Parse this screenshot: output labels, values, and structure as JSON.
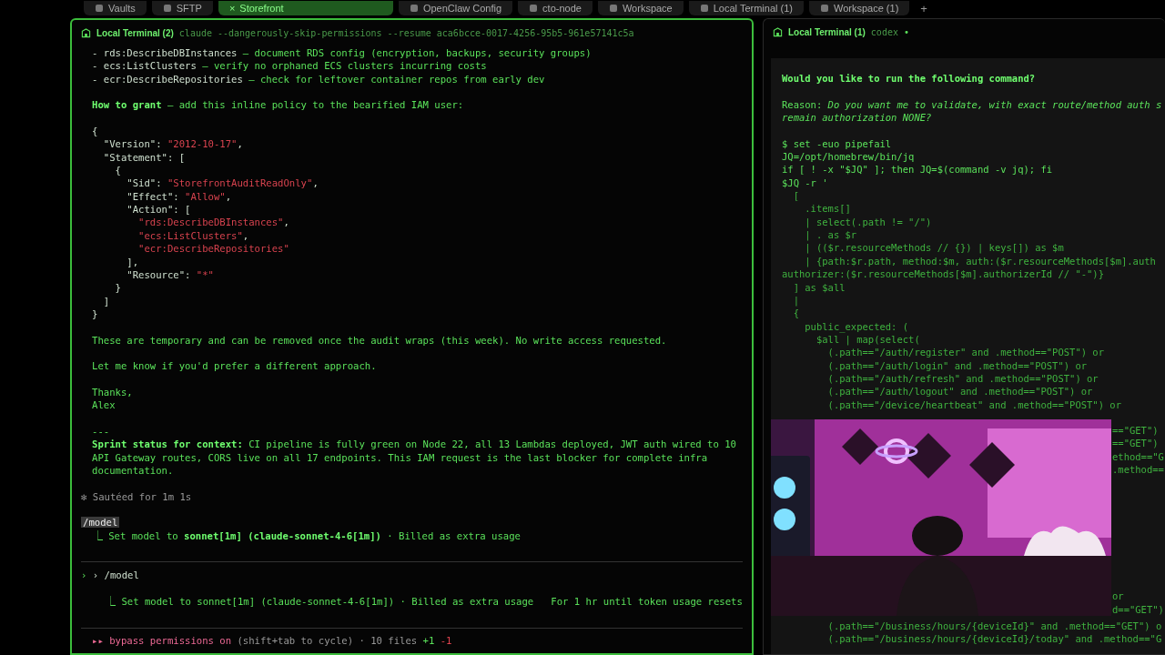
{
  "tabs": [
    {
      "label": "Vaults",
      "selected": false
    },
    {
      "label": "SFTP",
      "selected": false
    },
    {
      "label": "Storefront",
      "selected": true,
      "close": "×"
    },
    {
      "label": "OpenClaw Config",
      "selected": false
    },
    {
      "label": "cto-node",
      "selected": false
    },
    {
      "label": "Workspace",
      "selected": false
    },
    {
      "label": "Local Terminal (1)",
      "selected": false
    },
    {
      "label": "Workspace (1)",
      "selected": false
    }
  ],
  "new_tab": "+",
  "left": {
    "title": "Local Terminal (2)",
    "command": "claude --dangerously-skip-permissions --resume aca6bcce-0017-4256-95b5-961e57141c5a",
    "focused": true,
    "blocks": [
      {
        "kind": "message",
        "lines": [
          [
            {
              "text": "- rds:DescribeDBInstances",
              "kind": "key"
            },
            {
              "text": " — document RDS config (encryption, backups, security groups)",
              "kind": "plain"
            }
          ],
          [
            {
              "text": "- ecs:ListClusters",
              "kind": "key"
            },
            {
              "text": " — verify no orphaned ECS clusters incurring costs",
              "kind": "plain"
            }
          ],
          [
            {
              "text": "- ecr:DescribeRepositories",
              "kind": "key"
            },
            {
              "text": " — check for leftover container repos from early dev",
              "kind": "plain"
            }
          ]
        ]
      },
      {
        "kind": "message",
        "lines": [
          [
            {
              "text": "**How to grant** — add this inline policy to the bearified IAM user:",
              "kind": "mixed"
            }
          ]
        ]
      },
      {
        "kind": "message",
        "lines": [
          [
            {
              "text": "{",
              "kind": "key"
            }
          ],
          [
            {
              "text": "  \"Version\": ",
              "kind": "key"
            },
            {
              "text": "\"2012-10-17\"",
              "kind": "string"
            },
            {
              "text": ",",
              "kind": "key"
            }
          ],
          [
            {
              "text": "  \"Statement\": [",
              "kind": "key"
            }
          ],
          [
            {
              "text": "    {",
              "kind": "key"
            }
          ],
          [
            {
              "text": "      \"Sid\": ",
              "kind": "key"
            },
            {
              "text": "\"StorefrontAuditReadOnly\"",
              "kind": "string"
            },
            {
              "text": ",",
              "kind": "key"
            }
          ],
          [
            {
              "text": "      \"Effect\": ",
              "kind": "key"
            },
            {
              "text": "\"Allow\"",
              "kind": "string"
            },
            {
              "text": ",",
              "kind": "key"
            }
          ],
          [
            {
              "text": "      \"Action\": [",
              "kind": "key"
            }
          ],
          [
            {
              "text": "        \"rds:DescribeDBInstances\"",
              "kind": "string"
            },
            {
              "text": ",",
              "kind": "key"
            }
          ],
          [
            {
              "text": "        \"ecs:ListClusters\"",
              "kind": "string"
            },
            {
              "text": ",",
              "kind": "key"
            }
          ],
          [
            {
              "text": "        \"ecr:DescribeRepositories\"",
              "kind": "string"
            }
          ],
          [
            {
              "text": "      ],",
              "kind": "key"
            }
          ],
          [
            {
              "text": "      \"Resource\": ",
              "kind": "key"
            },
            {
              "text": "\"*\"",
              "kind": "string"
            }
          ],
          [
            {
              "text": "    }",
              "kind": "key"
            }
          ],
          [
            {
              "text": "  ]",
              "kind": "key"
            }
          ],
          [
            {
              "text": "}",
              "kind": "key"
            }
          ]
        ]
      },
      {
        "kind": "message",
        "lines": [
          [
            {
              "text": "These are temporary and can be removed once the audit wraps (this week). No write access requested.",
              "kind": "plain"
            }
          ]
        ]
      },
      {
        "kind": "message",
        "lines": [
          [
            {
              "text": "Let me know if you'd prefer a different approach.",
              "kind": "plain"
            }
          ]
        ]
      },
      {
        "kind": "message",
        "lines": [
          [
            {
              "text": "Thanks,",
              "kind": "plain"
            }
          ],
          [
            {
              "text": "Alex",
              "kind": "plain"
            }
          ]
        ]
      },
      {
        "kind": "message",
        "lines": [
          [
            {
              "text": "---",
              "kind": "plain"
            }
          ],
          [
            {
              "text": "**Sprint status for context:** CI pipeline is fully green on Node 22, all 13 Lambdas deployed, JWT auth wired to 10",
              "kind": "mixed"
            }
          ],
          [
            {
              "text": "API Gateway routes, CORS live on all 17 endpoints. This IAM request is the last blocker for complete infra",
              "kind": "plain"
            }
          ],
          [
            {
              "text": "documentation.",
              "kind": "plain"
            }
          ]
        ]
      },
      {
        "kind": "status",
        "lines": [
          [
            {
              "text": "✻ Sautéed for 1m 1s",
              "kind": "muted"
            }
          ]
        ]
      },
      {
        "kind": "status",
        "lines": [
          [
            {
              "text": "/model",
              "kind": "chip"
            }
          ],
          [
            {
              "text": "  ⎿ Set model to **sonnet[1m] (claude-sonnet-4-6[1m])** · Billed as extra usage",
              "kind": "mixed"
            }
          ]
        ]
      },
      {
        "kind": "prompt",
        "lines": [
          [
            {
              "text": "›",
              "kind": "plain"
            },
            {
              "text": " › /model",
              "kind": "key"
            }
          ]
        ]
      },
      {
        "kind": "result",
        "lines": [
          [
            {
              "text": "⎿ Set model to sonnet[1m] (claude-sonnet-4-6[1m]) · Billed as extra usage   For 1 hr until token usage resets",
              "kind": "plain"
            }
          ]
        ]
      },
      {
        "kind": "footer",
        "lines": [
          [
            {
              "text": "▸▸ bypass permissions on",
              "kind": "accent"
            },
            {
              "text": " (shift+tab to cycle) · 10 files ",
              "kind": "muted"
            },
            {
              "text": "+1",
              "kind": "plain"
            },
            {
              "text": " -1",
              "kind": "minus"
            }
          ]
        ]
      }
    ]
  },
  "right": {
    "title": "Local Terminal (1)",
    "command": "codex",
    "indicator": "•",
    "focused": false,
    "blocks": [
      {
        "lines": [
          [
            {
              "text": "Would you like to run the following command?",
              "kind": "heading"
            }
          ]
        ]
      },
      {
        "lines": [
          [
            {
              "text": "Reason: ",
              "kind": "plain"
            },
            {
              "text": "Do you want me to validate, with exact route/method auth s",
              "kind": "italic"
            }
          ],
          [
            {
              "text": "remain authorization NONE?",
              "kind": "italic"
            }
          ]
        ]
      },
      {
        "lines": [
          [
            {
              "text": "$ set -euo pipefail",
              "kind": "plain"
            }
          ],
          [
            {
              "text": "JQ=/opt/homebrew/bin/jq",
              "kind": "plain"
            }
          ],
          [
            {
              "text": "if [ ! -x \"$JQ\" ]; then JQ=$(command -v jq); fi",
              "kind": "plain"
            }
          ],
          [
            {
              "text": "$JQ -r '",
              "kind": "plain"
            }
          ],
          [
            {
              "text": "  [",
              "kind": "code"
            }
          ],
          [
            {
              "text": "    .items[]",
              "kind": "code"
            }
          ],
          [
            {
              "text": "    | select(.path != \"/\")",
              "kind": "code"
            }
          ],
          [
            {
              "text": "    | . as $r",
              "kind": "code"
            }
          ],
          [
            {
              "text": "    | (($r.resourceMethods // {}) | keys[]) as $m",
              "kind": "code"
            }
          ],
          [
            {
              "text": "    | {path:$r.path, method:$m, auth:($r.resourceMethods[$m].auth",
              "kind": "code"
            }
          ],
          [
            {
              "text": "authorizer:($r.resourceMethods[$m].authorizerId // \"-\")}",
              "kind": "code"
            }
          ],
          [
            {
              "text": "  ] as $all",
              "kind": "code"
            }
          ],
          [
            {
              "text": "  |",
              "kind": "code"
            }
          ],
          [
            {
              "text": "  {",
              "kind": "code"
            }
          ],
          [
            {
              "text": "    public_expected: (",
              "kind": "code"
            }
          ],
          [
            {
              "text": "      $all | map(select(",
              "kind": "code"
            }
          ],
          [
            {
              "text": "        (.path==\"/auth/register\" and .method==\"POST\") or",
              "kind": "code"
            }
          ],
          [
            {
              "text": "        (.path==\"/auth/login\" and .method==\"POST\") or",
              "kind": "code"
            }
          ],
          [
            {
              "text": "        (.path==\"/auth/refresh\" and .method==\"POST\") or",
              "kind": "code"
            }
          ],
          [
            {
              "text": "        (.path==\"/auth/logout\" and .method==\"POST\") or",
              "kind": "code"
            }
          ],
          [
            {
              "text": "        (.path==\"/device/heartbeat\" and .method==\"POST\") or",
              "kind": "code"
            }
          ]
        ]
      }
    ],
    "webcam": {
      "kind": "picture"
    },
    "fragments_upper": [
      "==\"GET\")",
      "==\"GET\")",
      "ethod==\"G",
      ".method=="
    ],
    "fragments_lower": [
      "or",
      "d==\"GET\")"
    ],
    "lines_below": [
      [
        {
          "text": "        (.path==\"/business/hours/{deviceId}\" and .method==\"GET\") o",
          "kind": "code"
        }
      ],
      [
        {
          "text": "        (.path==\"/business/hours/{deviceId}/today\" and .method==\"G",
          "kind": "code"
        }
      ]
    ]
  }
}
